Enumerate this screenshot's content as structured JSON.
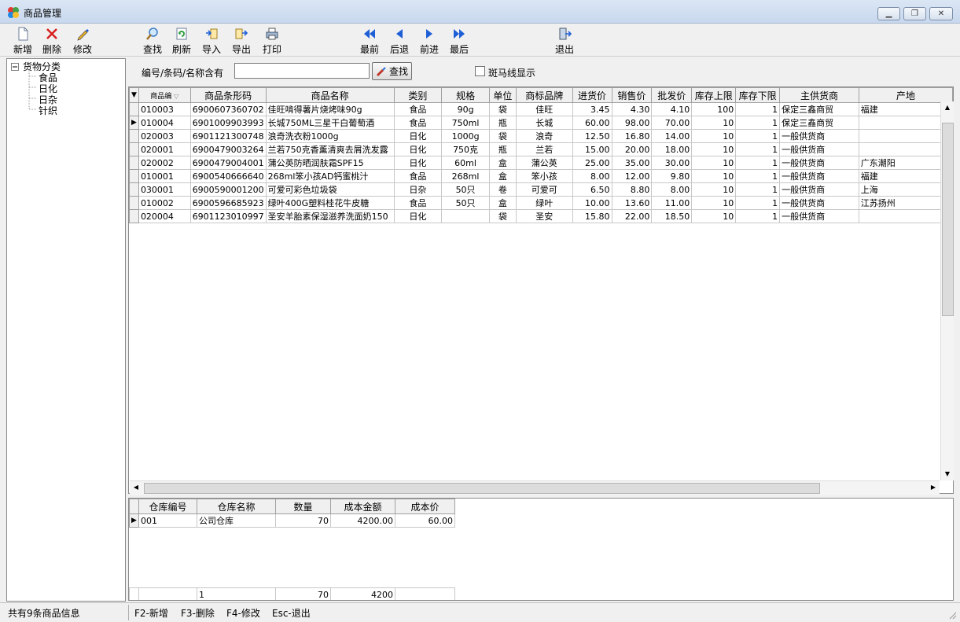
{
  "window": {
    "title": "商品管理"
  },
  "toolbar": {
    "add": "新增",
    "delete": "删除",
    "edit": "修改",
    "find": "查找",
    "refresh": "刷新",
    "import": "导入",
    "export": "导出",
    "print": "打印",
    "first": "最前",
    "prev": "后退",
    "next": "前进",
    "last": "最后",
    "exit": "退出"
  },
  "tree": {
    "root": "货物分类",
    "items": [
      "食品",
      "日化",
      "日杂",
      "针织"
    ]
  },
  "search": {
    "label": "编号/条码/名称含有",
    "value": "",
    "button": "查找",
    "zebra_label": "斑马线显示"
  },
  "goods_table": {
    "headers": [
      "商品编",
      "商品条形码",
      "商品名称",
      "类别",
      "规格",
      "单位",
      "商标品牌",
      "进货价",
      "销售价",
      "批发价",
      "库存上限",
      "库存下限",
      "主供货商",
      "产地"
    ],
    "rows": [
      [
        "010003",
        "6900607360702",
        "佳旺啃得薯片烧烤味90g",
        "食品",
        "90g",
        "袋",
        "佳旺",
        "3.45",
        "4.30",
        "4.10",
        "100",
        "1",
        "保定三鑫商贸",
        "福建"
      ],
      [
        "010004",
        "6901009903993",
        "长城750ML三星干白葡萄酒",
        "食品",
        "750ml",
        "瓶",
        "长城",
        "60.00",
        "98.00",
        "70.00",
        "10",
        "1",
        "保定三鑫商贸",
        ""
      ],
      [
        "020003",
        "6901121300748",
        "浪奇洗衣粉1000g",
        "日化",
        "1000g",
        "袋",
        "浪奇",
        "12.50",
        "16.80",
        "14.00",
        "10",
        "1",
        "一般供货商",
        ""
      ],
      [
        "020001",
        "6900479003264",
        "兰若750克香薰清爽去屑洗发露",
        "日化",
        "750克",
        "瓶",
        "兰若",
        "15.00",
        "20.00",
        "18.00",
        "10",
        "1",
        "一般供货商",
        ""
      ],
      [
        "020002",
        "6900479004001",
        "蒲公英防晒润肤霜SPF15",
        "日化",
        "60ml",
        "盒",
        "蒲公英",
        "25.00",
        "35.00",
        "30.00",
        "10",
        "1",
        "一般供货商",
        "广东潮阳"
      ],
      [
        "010001",
        "6900540666640",
        "268ml笨小孩AD钙蜜桃汁",
        "食品",
        "268ml",
        "盒",
        "笨小孩",
        "8.00",
        "12.00",
        "9.80",
        "10",
        "1",
        "一般供货商",
        "福建"
      ],
      [
        "030001",
        "6900590001200",
        "可爱可彩色垃圾袋",
        "日杂",
        "50只",
        "卷",
        "可爱可",
        "6.50",
        "8.80",
        "8.00",
        "10",
        "1",
        "一般供货商",
        "上海"
      ],
      [
        "010002",
        "6900596685923",
        "绿叶400G塑料桂花牛皮糖",
        "食品",
        "50只",
        "盒",
        "绿叶",
        "10.00",
        "13.60",
        "11.00",
        "10",
        "1",
        "一般供货商",
        "江苏扬州"
      ],
      [
        "020004",
        "6901123010997",
        "圣安羊胎素保湿滋养洗面奶150",
        "日化",
        "",
        "袋",
        "圣安",
        "15.80",
        "22.00",
        "18.50",
        "10",
        "1",
        "一般供货商",
        ""
      ]
    ]
  },
  "stock_table": {
    "headers": [
      "仓库编号",
      "仓库名称",
      "数量",
      "成本金额",
      "成本价"
    ],
    "rows": [
      [
        "001",
        "公司仓库",
        "70",
        "4200.00",
        "60.00"
      ]
    ],
    "footer": [
      "",
      "1",
      "70",
      "4200",
      ""
    ]
  },
  "status": {
    "info": "共有9条商品信息",
    "f2": "F2-新增",
    "f3": "F3-删除",
    "f4": "F4-修改",
    "esc": "Esc-退出"
  },
  "colors": {
    "title_bg": "#c8d8ee",
    "arrow_blue": "#1f5fd6",
    "delete_red": "#d81e1e"
  }
}
